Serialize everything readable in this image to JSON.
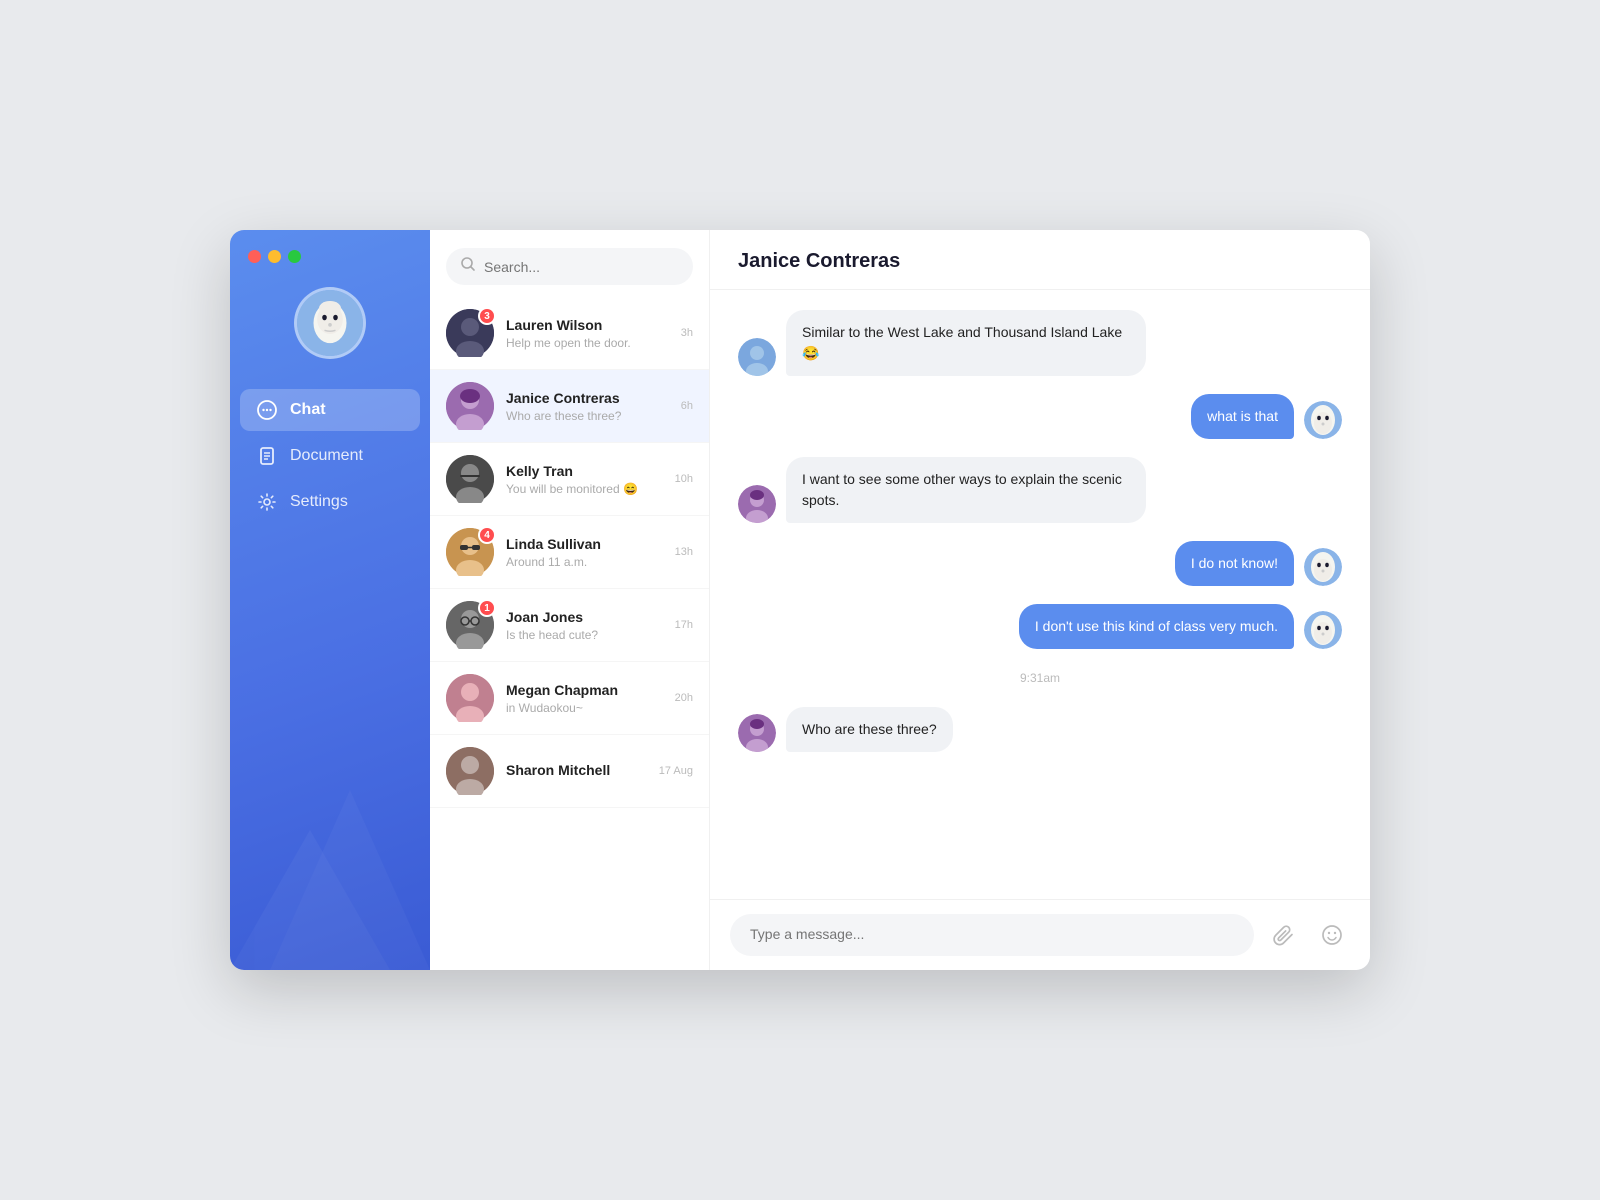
{
  "window": {
    "title": "Chat App"
  },
  "traffic_lights": {
    "red": "close",
    "yellow": "minimize",
    "green": "maximize"
  },
  "sidebar": {
    "nav": [
      {
        "id": "chat",
        "label": "Chat",
        "icon": "chat-icon",
        "active": true
      },
      {
        "id": "document",
        "label": "Document",
        "icon": "document-icon",
        "active": false
      },
      {
        "id": "settings",
        "label": "Settings",
        "icon": "settings-icon",
        "active": false
      }
    ]
  },
  "search": {
    "placeholder": "Search..."
  },
  "contacts": [
    {
      "id": 1,
      "name": "Lauren Wilson",
      "preview": "Help me open the door.",
      "time": "3h",
      "badge": "3",
      "color": "av-dark"
    },
    {
      "id": 2,
      "name": "Janice Contreras",
      "preview": "Who are these three?",
      "time": "6h",
      "badge": "",
      "color": "av-purple",
      "active": true
    },
    {
      "id": 3,
      "name": "Kelly Tran",
      "preview": "You will be monitored 😄",
      "time": "10h",
      "badge": "",
      "color": "av-dark"
    },
    {
      "id": 4,
      "name": "Linda Sullivan",
      "preview": "Around 11 a.m.",
      "time": "13h",
      "badge": "4",
      "color": "av-amber"
    },
    {
      "id": 5,
      "name": "Joan Jones",
      "preview": "Is the head cute?",
      "time": "17h",
      "badge": "1",
      "color": "av-gray"
    },
    {
      "id": 6,
      "name": "Megan Chapman",
      "preview": "in Wudaokou~",
      "time": "20h",
      "badge": "",
      "color": "av-pink"
    },
    {
      "id": 7,
      "name": "Sharon Mitchell",
      "preview": "",
      "time": "17 Aug",
      "badge": "",
      "color": "av-brown"
    }
  ],
  "chat": {
    "contact_name": "Janice Contreras",
    "messages": [
      {
        "id": 1,
        "type": "incoming",
        "text": "Similar to the West Lake and Thousand Island Lake 😂",
        "avatar_color": "av-blue"
      },
      {
        "id": 2,
        "type": "outgoing",
        "text": "what is that",
        "avatar_color": "av-mask"
      },
      {
        "id": 3,
        "type": "incoming",
        "text": "I want to see some other ways to explain the scenic spots.",
        "avatar_color": "av-purple"
      },
      {
        "id": 4,
        "type": "outgoing",
        "text": "I do not know!",
        "avatar_color": "av-mask"
      },
      {
        "id": 5,
        "type": "outgoing",
        "text": "I don't use this kind of class very much.",
        "avatar_color": "av-mask"
      },
      {
        "id": 6,
        "type": "timestamp",
        "text": "9:31am"
      },
      {
        "id": 7,
        "type": "incoming",
        "text": "Who are these three?",
        "avatar_color": "av-purple"
      }
    ],
    "input_placeholder": "Type a message..."
  }
}
